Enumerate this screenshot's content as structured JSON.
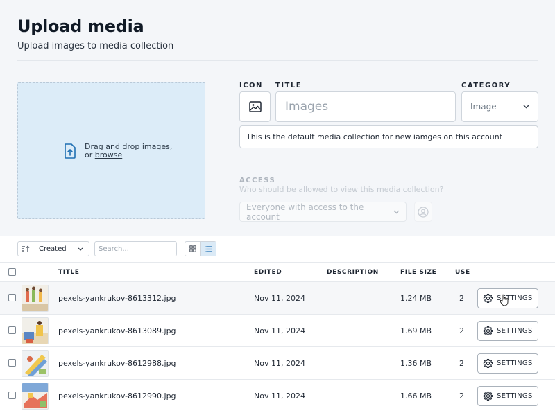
{
  "header": {
    "title": "Upload media",
    "subtitle": "Upload images to media collection"
  },
  "dropzone": {
    "icon": "upload-file-icon",
    "text": "Drag and drop images,",
    "or_text": "or ",
    "browse_label": "browse"
  },
  "form": {
    "icon_label": "ICON",
    "icon_value": "image-icon",
    "title_label": "TITLE",
    "title_placeholder": "Images",
    "category_label": "CATEGORY",
    "category_value": "Image",
    "description_value": "This is the default media collection for new iamges on this account",
    "access_label": "ACCESS",
    "access_help": "Who should be allowed to view this media collection?",
    "access_value": "Everyone with access to the account",
    "access_user_icon": "user-circle-icon"
  },
  "toolbar": {
    "sort_icon": "sort-ascending-icon",
    "sort_value": "Created",
    "search_placeholder": "Search...",
    "grid_view_icon": "grid-view-icon",
    "list_view_icon": "list-view-icon"
  },
  "table": {
    "columns": {
      "title": "TITLE",
      "edited": "EDITED",
      "description": "DESCRIPTION",
      "file_size": "FILE SIZE",
      "use": "USE"
    },
    "rows": [
      {
        "title": "pexels-yankrukov-8613312.jpg",
        "edited": "Nov 11, 2024",
        "description": "",
        "file_size": "1.24 MB",
        "use": "2",
        "action": "SETTINGS"
      },
      {
        "title": "pexels-yankrukov-8613089.jpg",
        "edited": "Nov 11, 2024",
        "description": "",
        "file_size": "1.69 MB",
        "use": "2",
        "action": "SETTINGS"
      },
      {
        "title": "pexels-yankrukov-8612988.jpg",
        "edited": "Nov 11, 2024",
        "description": "",
        "file_size": "1.36 MB",
        "use": "2",
        "action": "SETTINGS"
      },
      {
        "title": "pexels-yankrukov-8612990.jpg",
        "edited": "Nov 11, 2024",
        "description": "",
        "file_size": "1.66 MB",
        "use": "2",
        "action": "SETTINGS"
      }
    ]
  },
  "colors": {
    "page_background": "#f4f6f9",
    "dropzone_fill": "#dcecf8",
    "accent_blue": "#1f6fb2",
    "active_view": "#dbeaf6"
  }
}
